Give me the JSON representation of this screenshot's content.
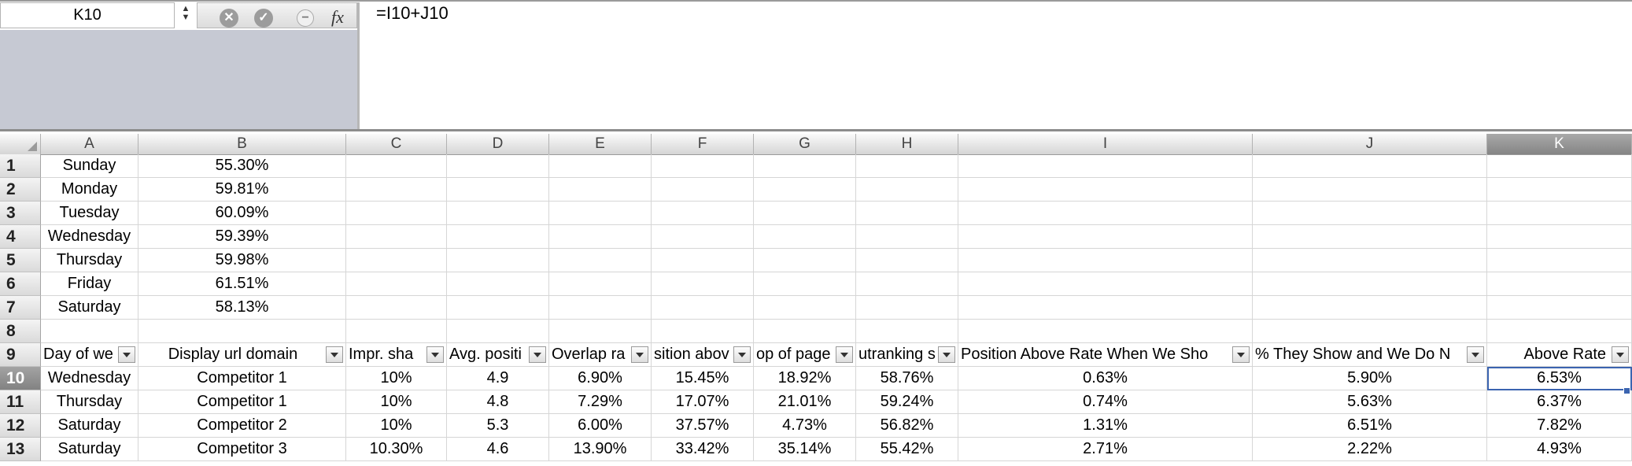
{
  "formula_bar": {
    "name_box": "K10",
    "formula": "=I10+J10",
    "icons": [
      "stepper-icon",
      "cancel-icon",
      "enter-check-icon",
      "function-circle-icon",
      "fx-icon"
    ]
  },
  "columns": [
    "A",
    "B",
    "C",
    "D",
    "E",
    "F",
    "G",
    "H",
    "I",
    "J",
    "K"
  ],
  "selected_column": "K",
  "rows": [
    {
      "n": "1",
      "cells": [
        "Sunday",
        "55.30%",
        "",
        "",
        "",
        "",
        "",
        "",
        "",
        "",
        ""
      ]
    },
    {
      "n": "2",
      "cells": [
        "Monday",
        "59.81%",
        "",
        "",
        "",
        "",
        "",
        "",
        "",
        "",
        ""
      ]
    },
    {
      "n": "3",
      "cells": [
        "Tuesday",
        "60.09%",
        "",
        "",
        "",
        "",
        "",
        "",
        "",
        "",
        ""
      ]
    },
    {
      "n": "4",
      "cells": [
        "Wednesday",
        "59.39%",
        "",
        "",
        "",
        "",
        "",
        "",
        "",
        "",
        ""
      ]
    },
    {
      "n": "5",
      "cells": [
        "Thursday",
        "59.98%",
        "",
        "",
        "",
        "",
        "",
        "",
        "",
        "",
        ""
      ]
    },
    {
      "n": "6",
      "cells": [
        "Friday",
        "61.51%",
        "",
        "",
        "",
        "",
        "",
        "",
        "",
        "",
        ""
      ]
    },
    {
      "n": "7",
      "cells": [
        "Saturday",
        "58.13%",
        "",
        "",
        "",
        "",
        "",
        "",
        "",
        "",
        ""
      ]
    },
    {
      "n": "8",
      "cells": [
        "",
        "",
        "",
        "",
        "",
        "",
        "",
        "",
        "",
        "",
        ""
      ]
    },
    {
      "n": "9",
      "cells": [
        "Day of we",
        "Display url domain",
        "Impr. sha",
        "Avg. positi",
        "Overlap ra",
        "sition abov",
        "op of page",
        "utranking s",
        "Position Above Rate When We Sho",
        "% They Show and We Do N",
        "Above Rate"
      ]
    },
    {
      "n": "10",
      "cells": [
        "Wednesday",
        "Competitor 1",
        "10%",
        "4.9",
        "6.90%",
        "15.45%",
        "18.92%",
        "58.76%",
        "0.63%",
        "5.90%",
        "6.53%"
      ]
    },
    {
      "n": "11",
      "cells": [
        "Thursday",
        "Competitor 1",
        "10%",
        "4.8",
        "7.29%",
        "17.07%",
        "21.01%",
        "59.24%",
        "0.74%",
        "5.63%",
        "6.37%"
      ]
    },
    {
      "n": "12",
      "cells": [
        "Saturday",
        "Competitor 2",
        "10%",
        "5.3",
        "6.00%",
        "37.57%",
        "4.73%",
        "56.82%",
        "1.31%",
        "6.51%",
        "7.82%"
      ]
    },
    {
      "n": "13",
      "cells": [
        "Saturday",
        "Competitor 3",
        "10.30%",
        "4.6",
        "13.90%",
        "33.42%",
        "35.14%",
        "55.42%",
        "2.71%",
        "2.22%",
        "4.93%"
      ]
    }
  ],
  "header_row": "9",
  "selected_row": "10",
  "active_cell": "K10"
}
